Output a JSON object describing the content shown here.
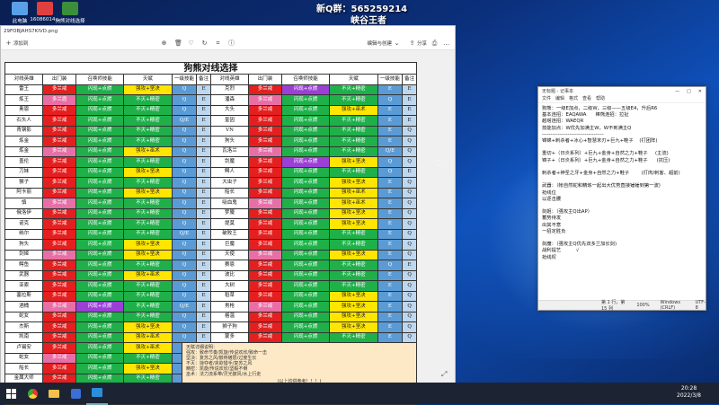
{
  "stream": {
    "qq_group": "新Q群：565259214",
    "streamer": "峡谷王者"
  },
  "desktop_icons": [
    {
      "label": "此电脑",
      "color": "#5aa0e8"
    },
    {
      "label": "16086014...",
      "color": "#e04040"
    },
    {
      "label": "狗熊对线选择",
      "color": "#3a8f3a"
    }
  ],
  "photos_window": {
    "title": "29FOBJAHS7KIVD.png",
    "toolbar": {
      "add_label": "添加到",
      "edit_label": "编辑与创建",
      "share_label": "分享"
    }
  },
  "sheet": {
    "title": "狗熊对线选择",
    "headers": [
      "对线英雄",
      "出门装",
      "召唤师技能",
      "天赋",
      "一级技能",
      "备注",
      "对线英雄",
      "出门装",
      "召唤师技能",
      "天赋",
      "一级技能",
      "备注"
    ],
    "rows": [
      [
        "雷王",
        "多兰戒",
        "闪现+点燃",
        "强攻+坚决",
        "Q",
        "E",
        "克烈",
        "多兰戒",
        "闪现+点燃",
        "不灭+精密",
        "E",
        "E"
      ],
      [
        "炼王",
        "多兰盾",
        "闪现+点燃",
        "不灭+精密",
        "Q",
        "E",
        "潘森",
        "多兰戒",
        "闪现+点燃",
        "不灭+精密",
        "Q",
        "E"
      ],
      [
        "奥恩",
        "多兰戒",
        "闪现+点燃",
        "不灭+精密",
        "Q",
        "E",
        "大头",
        "多兰戒",
        "闪现+点燃",
        "强攻+巫术",
        "E",
        "E"
      ],
      [
        "石头人",
        "多兰戒",
        "闪现+点燃",
        "不灭+精密",
        "Q/E",
        "E",
        "奎因",
        "多兰戒",
        "闪现+点燃",
        "不灭+精密",
        "E",
        "E"
      ],
      [
        "青钢影",
        "多兰戒",
        "闪现+点燃",
        "不灭+精密",
        "Q",
        "E",
        "VN",
        "多兰戒",
        "闪现+点燃",
        "不灭+精密",
        "E",
        "Q"
      ],
      [
        "炼金",
        "多兰戒",
        "闪现+点燃",
        "不灭+精密",
        "Q",
        "E",
        "狗头",
        "多兰戒",
        "闪现+点燃",
        "不灭+精密",
        "E",
        "Q"
      ],
      [
        "炼金",
        "多兰戒",
        "闪现+点燃",
        "强攻+巫术",
        "Q",
        "E",
        "瓦洛兰",
        "多兰戒",
        "闪现+点燃",
        "不灭+精密",
        "Q/E",
        "Q"
      ],
      [
        "盖伦",
        "多兰戒",
        "闪现+点燃",
        "不灭+精密",
        "Q",
        "E",
        "剑魔",
        "多兰戒",
        "闪现+点燃",
        "强攻+坚决",
        "Q",
        "Q"
      ],
      [
        "刀妹",
        "多兰戒",
        "闪现+点燃",
        "强攻+坚决",
        "Q",
        "E",
        "鳄人",
        "多兰戒",
        "闪现+点燃",
        "不灭+精密",
        "Q",
        "E"
      ],
      [
        "猴子",
        "多兰戒",
        "闪现+点燃",
        "不灭+精密",
        "Q",
        "E",
        "大虫子",
        "多兰戒",
        "闪现+点燃",
        "强攻+坚决",
        "E",
        "Q"
      ],
      [
        "阿卡丽",
        "多兰戒",
        "闪现+点燃",
        "强攻+坚决",
        "Q",
        "E",
        "船长",
        "多兰戒",
        "闪现+点燃",
        "强攻+巫术",
        "E",
        "Q"
      ],
      [
        "慎",
        "多兰戒",
        "闪现+点燃",
        "不灭+精密",
        "Q",
        "E",
        "吸血鬼",
        "多兰戒",
        "闪现+点燃",
        "强攻+巫术",
        "E",
        "Q"
      ],
      [
        "俄洛伊",
        "多兰戒",
        "闪现+点燃",
        "不灭+精密",
        "Q",
        "E",
        "梦魇",
        "多兰戒",
        "闪现+点燃",
        "强攻+坚决",
        "E",
        "Q"
      ],
      [
        "诺克",
        "多兰戒",
        "闪现+点燃",
        "不灭+精密",
        "Q",
        "E",
        "提莫",
        "多兰戒",
        "闪现+点燃",
        "强攻+坚决",
        "E",
        "Q"
      ],
      [
        "纳尔",
        "多兰戒",
        "闪现+点燃",
        "不灭+精密",
        "Q/E",
        "E",
        "破败王",
        "多兰戒",
        "闪现+点燃",
        "不灭+精密",
        "E",
        "Q"
      ],
      [
        "狗头",
        "多兰戒",
        "闪现+点燃",
        "强攻+坚决",
        "Q",
        "E",
        "巨魔",
        "多兰戒",
        "闪现+点燃",
        "不灭+精密",
        "E",
        "Q"
      ],
      [
        "剑姬",
        "多兰戒",
        "闪现+点燃",
        "强攻+坚决",
        "Q",
        "E",
        "天使",
        "多兰戒",
        "闪现+点燃",
        "强攻+坚决",
        "E",
        "Q"
      ],
      [
        "鳄鱼",
        "多兰戒",
        "闪现+点燃",
        "不灭+精密",
        "Q",
        "E",
        "赛恩",
        "多兰戒",
        "闪现+点燃",
        "不灭+精密",
        "Q",
        "E"
      ],
      [
        "武器",
        "多兰戒",
        "闪现+点燃",
        "强攻+巫术",
        "Q",
        "E",
        "波比",
        "多兰戒",
        "闪现+点燃",
        "不灭+精密",
        "E",
        "Q"
      ],
      [
        "亚索",
        "多兰戒",
        "闪现+点燃",
        "不灭+精密",
        "Q",
        "E",
        "大树",
        "多兰戒",
        "闪现+点燃",
        "不灭+精密",
        "E",
        "Q"
      ],
      [
        "塞拉斯",
        "多兰戒",
        "闪现+点燃",
        "不灭+精密",
        "Q",
        "E",
        "稻草",
        "多兰戒",
        "闪现+点燃",
        "强攻+坚决",
        "E",
        "Q"
      ],
      [
        "酒桶",
        "多兰戒",
        "闪现+点燃",
        "不灭+精密",
        "Q/E",
        "E",
        "男枪",
        "多兰戒",
        "闪现+点燃",
        "强攻+坚决",
        "E",
        "Q"
      ],
      [
        "蛇女",
        "多兰戒",
        "闪现+点燃",
        "不灭+精密",
        "Q",
        "E",
        "格温",
        "多兰戒",
        "闪现+点燃",
        "强攻+坚决",
        "E",
        "Q"
      ],
      [
        "杰斯",
        "多兰戒",
        "闪现+点燃",
        "强攻+坚决",
        "Q",
        "E",
        "狮子狗",
        "多兰戒",
        "闪现+点燃",
        "强攻+坚决",
        "E",
        "Q"
      ],
      [
        "凯南",
        "多兰戒",
        "闪现+点燃",
        "强攻+巫术",
        "Q",
        "E",
        "蒙多",
        "多兰戒",
        "闪现+点燃",
        "不灭+精密",
        "E",
        "Q"
      ],
      [
        "卢锡安",
        "多兰戒",
        "闪现+点燃",
        "强攻+巫术",
        "Q",
        "E",
        "",
        "",
        "",
        "",
        "",
        ""
      ],
      [
        "蛇女",
        "多兰戒",
        "闪现+点燃",
        "不灭+精密",
        "Q",
        "E",
        "",
        "",
        "",
        "",
        "",
        ""
      ],
      [
        "船长",
        "多兰戒",
        "闪现+点燃",
        "强攻+坚决",
        "Q",
        "E",
        "",
        "",
        "",
        "",
        "",
        ""
      ],
      [
        "金属大师",
        "多兰戒",
        "闪现+点燃",
        "不灭+精密",
        "Q",
        "E",
        "",
        "",
        "",
        "",
        "",
        ""
      ],
      [
        "奥拉夫",
        "多兰戒",
        "闪现+点燃",
        "强攻+坚决",
        "Q",
        "E",
        "",
        "",
        "",
        "",
        "",
        ""
      ],
      [
        "乐芙兰",
        "多兰戒",
        "闪现+点燃",
        "强攻+坚决",
        "Q",
        "E",
        "",
        "",
        "",
        "",
        "",
        ""
      ]
    ],
    "notes": [
      "天赋详细说明：",
      "强攻：致命节奏/凯旋/传说欢欣/致命一击",
      "坚决：复苏之风/骸骨镀层/过度生长",
      "不灭：掠夺者/贪欲猎手/复苏之风",
      "精密：凯旋/传说欢欣/坚毅不倒",
      "巫术：法力流系带/灵光披风/水上行走",
      "(以上均供参考！！！)"
    ]
  },
  "notepad": {
    "title": "无标题 - 记事本",
    "menu": [
      "文件",
      "编辑",
      "格式",
      "查看",
      "帮助"
    ],
    "lines": [
      "狗熊：一级E加点，二级W，三级——五级E4，升后R6",
      "基本连招：EAQAWA      棒熊连招：拉扯",
      "越塔连招：WAEQR",
      "技能加点：W优先加满主W，W不到满主Q",
      "------------------------------------",
      "锦锦+刺杀者+冰心+智慧末刃+巨九+鞋子    (打团阵)",
      "",
      "重切+（日炎系列）+巨九+金身+自然之力+鞋子     (主流)",
      "锦子+（日炎系列）+巨九+金身+自然之力+鞋子      (抗压)",
      "",
      "刺杀者+神圣之牙+金身+自然之力+鞋子        (打肉/刺客、超前)",
      "",
      "武器：（帐自然蛇和精炼一起出大优势直接锤锤到第一波)",
      "抢线位",
      "以逐击腰",
      "",
      "剑姬：（强攻主Q出AP）",
      "蓄势待发",
      "出其不意",
      "一招定胜负",
      "",
      "剑魔：（强攻主Q优先双多兰加长剑)",
      "战利提艺          √",
      "抢线权"
    ],
    "status": {
      "position": "第 1 行，第 15 列",
      "zoom": "100%",
      "eol": "Windows (CRLF)",
      "encoding": "UTF-8"
    }
  },
  "taskbar": {
    "time": "20:28",
    "date": "2022/3/8"
  }
}
